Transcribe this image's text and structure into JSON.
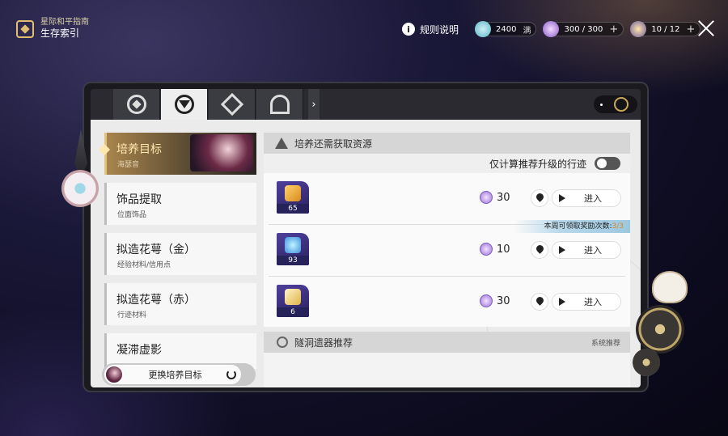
{
  "app": {
    "subtitle": "星际和平指南",
    "title": "生存索引"
  },
  "topbar": {
    "rules_label": "规则说明",
    "resources": [
      {
        "name": "fuel",
        "value": "2400",
        "extra": "满"
      },
      {
        "name": "power",
        "value": "300 / 300",
        "extra": "+"
      },
      {
        "name": "reserve",
        "value": "10 / 12",
        "extra": "+"
      }
    ]
  },
  "tabs": [
    "tab-1",
    "tab-2",
    "tab-3",
    "tab-4"
  ],
  "sidebar": {
    "items": [
      {
        "title": "培养目标",
        "subtitle": "海瑟音"
      },
      {
        "title": "饰品提取",
        "subtitle": "位面饰品"
      },
      {
        "title": "拟造花萼（金）",
        "subtitle": "经验材料/信用点"
      },
      {
        "title": "拟造花萼（赤）",
        "subtitle": "行迹材料"
      },
      {
        "title": "凝滞虚影",
        "subtitle": ""
      }
    ],
    "switch_label": "更换培养目标"
  },
  "panel": {
    "header": "培养还需获取资源",
    "toggle_label": "仅计算推荐升级的行迹",
    "toggle_on": false,
    "rows": [
      {
        "count": "65",
        "cost": "30",
        "enter_label": "进入"
      },
      {
        "count": "93",
        "cost": "10",
        "enter_label": "进入"
      },
      {
        "count": "6",
        "cost": "30",
        "enter_label": "进入"
      }
    ],
    "weekly_prefix": "本周可领取奖励次数:",
    "weekly_value": "3/3",
    "rec_header": "隧洞遗器推荐",
    "rec_right": "系统推荐"
  }
}
